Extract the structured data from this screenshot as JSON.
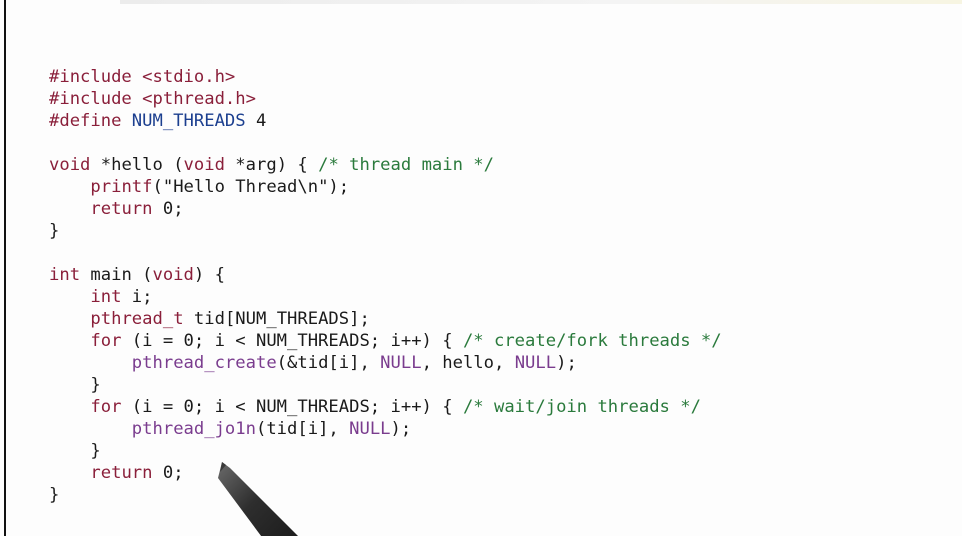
{
  "code_lines": [
    [
      {
        "t": "#include",
        "c": "preproc"
      },
      {
        "t": " <stdio.h>",
        "c": "preproc"
      }
    ],
    [
      {
        "t": "#include",
        "c": "preproc"
      },
      {
        "t": " <pthread.h>",
        "c": "preproc"
      }
    ],
    [
      {
        "t": "#define",
        "c": "preproc"
      },
      {
        "t": " NUM_THREADS",
        "c": "macro"
      },
      {
        "t": " 4",
        "c": "num"
      }
    ],
    [],
    [
      {
        "t": "void",
        "c": "kw"
      },
      {
        "t": " *hello (",
        "c": "plain"
      },
      {
        "t": "void",
        "c": "kw"
      },
      {
        "t": " *arg) { ",
        "c": "plain"
      },
      {
        "t": "/* thread main */",
        "c": "comment"
      }
    ],
    [
      {
        "t": "    ",
        "c": "plain"
      },
      {
        "t": "printf",
        "c": "kw"
      },
      {
        "t": "(\"Hello Thread\\n\");",
        "c": "str"
      }
    ],
    [
      {
        "t": "    ",
        "c": "plain"
      },
      {
        "t": "return",
        "c": "kw"
      },
      {
        "t": " 0;",
        "c": "num"
      }
    ],
    [
      {
        "t": "}",
        "c": "plain"
      }
    ],
    [],
    [
      {
        "t": "int",
        "c": "kw"
      },
      {
        "t": " main (",
        "c": "plain"
      },
      {
        "t": "void",
        "c": "kw"
      },
      {
        "t": ") {",
        "c": "plain"
      }
    ],
    [
      {
        "t": "    ",
        "c": "plain"
      },
      {
        "t": "int",
        "c": "kw"
      },
      {
        "t": " i;",
        "c": "plain"
      }
    ],
    [
      {
        "t": "    ",
        "c": "plain"
      },
      {
        "t": "pthread_t",
        "c": "kw"
      },
      {
        "t": " tid[",
        "c": "plain"
      },
      {
        "t": "NUM_THREADS",
        "c": "plain"
      },
      {
        "t": "];",
        "c": "plain"
      }
    ],
    [
      {
        "t": "    ",
        "c": "plain"
      },
      {
        "t": "for",
        "c": "kw"
      },
      {
        "t": " (i = 0; i < NUM_THREADS; i++) { ",
        "c": "plain"
      },
      {
        "t": "/* create/fork threads */",
        "c": "comment"
      }
    ],
    [
      {
        "t": "        ",
        "c": "plain"
      },
      {
        "t": "pthread_create",
        "c": "call"
      },
      {
        "t": "(&tid[i], ",
        "c": "plain"
      },
      {
        "t": "NULL",
        "c": "call"
      },
      {
        "t": ", hello, ",
        "c": "plain"
      },
      {
        "t": "NULL",
        "c": "call"
      },
      {
        "t": ");",
        "c": "plain"
      }
    ],
    [
      {
        "t": "    }",
        "c": "plain"
      }
    ],
    [
      {
        "t": "    ",
        "c": "plain"
      },
      {
        "t": "for",
        "c": "kw"
      },
      {
        "t": " (i = 0; i < NUM_THREADS; i++) { ",
        "c": "plain"
      },
      {
        "t": "/* wait/join threads */",
        "c": "comment"
      }
    ],
    [
      {
        "t": "        ",
        "c": "plain"
      },
      {
        "t": "pthread_jo1n",
        "c": "call"
      },
      {
        "t": "(tid[i], ",
        "c": "plain"
      },
      {
        "t": "NULL",
        "c": "call"
      },
      {
        "t": ");",
        "c": "plain"
      }
    ],
    [
      {
        "t": "    }",
        "c": "plain"
      }
    ],
    [
      {
        "t": "    ",
        "c": "plain"
      },
      {
        "t": "return",
        "c": "kw"
      },
      {
        "t": " 0;",
        "c": "num"
      }
    ],
    [
      {
        "t": "}",
        "c": "plain"
      }
    ]
  ],
  "pen_icon": "pen-tip-icon"
}
